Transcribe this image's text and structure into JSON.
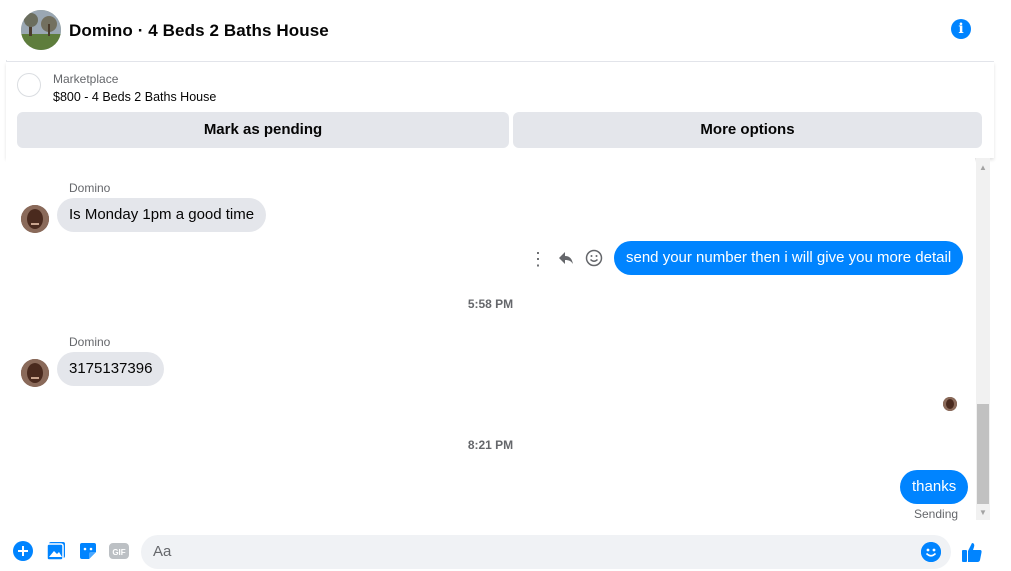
{
  "header": {
    "title": "Domino · 4 Beds 2 Baths House",
    "info_icon": "info-icon"
  },
  "marketplace": {
    "label": "Marketplace",
    "listing": "$800 - 4 Beds 2 Baths House",
    "pending_button": "Mark as pending",
    "more_button": "More options"
  },
  "messages": {
    "msg1": {
      "sender": "Domino",
      "text": "Is Monday 1pm a good time"
    },
    "msg2": {
      "text": "send your number then i will give you more detail"
    },
    "time1": "5:58 PM",
    "msg3": {
      "sender": "Domino",
      "text": "3175137396"
    },
    "time2": "8:21 PM",
    "msg4": {
      "text": "thanks",
      "status": "Sending"
    }
  },
  "composer": {
    "placeholder": "Aa"
  },
  "colors": {
    "accent": "#0084ff",
    "incoming_bubble": "#e4e6eb"
  }
}
